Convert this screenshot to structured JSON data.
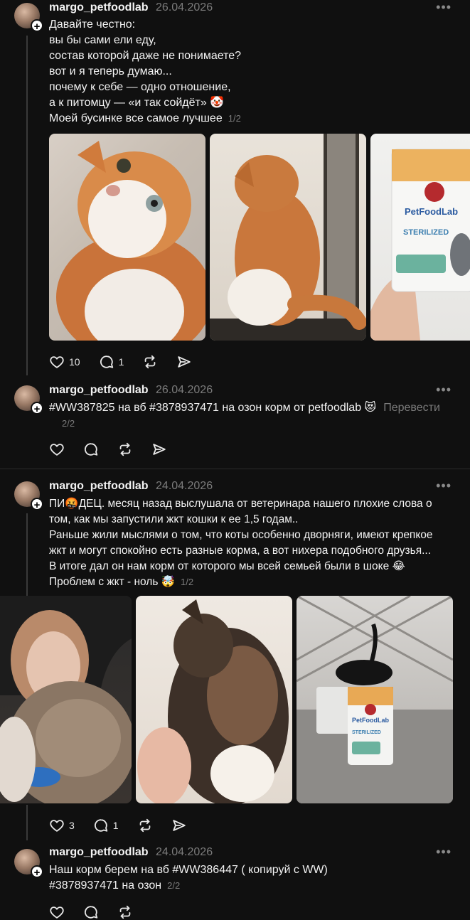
{
  "posts": [
    {
      "username": "margo_petfoodlab",
      "date": "26.04.2026",
      "lines": [
        "Давайте честно:",
        "вы бы сами ели еду,",
        "состав которой даже не понимаете?",
        "вот и я теперь думаю...",
        "почему к себе — одно отношение,",
        "а к питомцу — «и так сойдёт» 🤡",
        "Моей бусинке все самое лучшее"
      ],
      "page": "1/2",
      "images": [
        "orange-white cat close-up",
        "cat sitting on tiles",
        "PetFoodLab sterilized food bag"
      ],
      "package": {
        "brand": "PetFoodLab",
        "variant": "STERILIZED"
      },
      "likes": "10",
      "replies": "1"
    },
    {
      "username": "margo_petfoodlab",
      "date": "26.04.2026",
      "lines": [
        "#WW387825 на вб #3878937471 на озон корм от petfoodlab 😻"
      ],
      "translate": "Перевести",
      "page": "2/2"
    },
    {
      "username": "margo_petfoodlab",
      "date": "24.04.2026",
      "lines": [
        "ПИ🤬ДЕЦ. месяц назад выслушала от ветеринара нашего плохие слова о",
        "том, как мы запустили жкт кошки к ее 1,5 годам..",
        "Раньше жили мыслями о том, что коты особенно дворняги, имеют крепкое",
        "жкт и могут спокойно есть разные корма, а вот нихера подобного друзья...",
        "В итоге дал он нам корм от которого мы всей семьей были в шоке 😂",
        "Проблем с жкт - ноль 🤯"
      ],
      "page": "1/2",
      "images": [
        "woman hugging tabby cat",
        "calico cat on blanket",
        "black cat with PetFoodLab bags"
      ],
      "package": {
        "brand": "PetFoodLab",
        "variant": "STERILIZED"
      },
      "likes": "3",
      "replies": "1"
    },
    {
      "username": "margo_petfoodlab",
      "date": "24.04.2026",
      "lines": [
        "Наш корм берем на вб #WW386447 ( копируй с WW)",
        "#3878937471 на озон"
      ],
      "page": "2/2"
    }
  ],
  "icons": [
    "heart-icon",
    "comment-icon",
    "repost-icon",
    "share-icon",
    "more-icon",
    "follow-plus-icon"
  ],
  "colors": {
    "background": "#101010",
    "text": "#f3f3f3",
    "muted": "#7b7b7b",
    "thread": "#3a3a3a"
  }
}
